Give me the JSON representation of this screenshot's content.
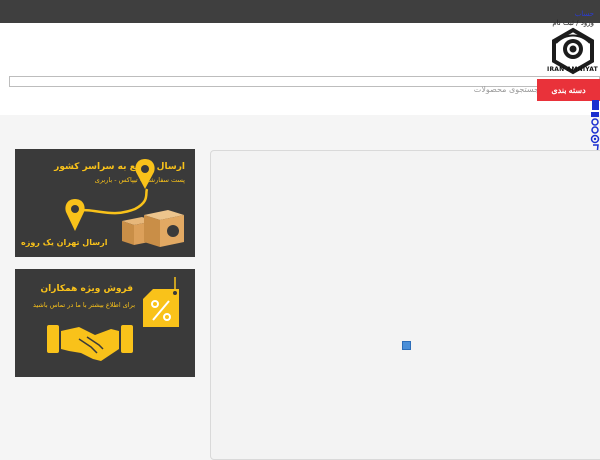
{
  "header": {
    "account_link": "حساب",
    "login_register": "ورود / ثبت نام",
    "brand": "IRAN AMNIYAT"
  },
  "search": {
    "placeholder": "جستجوی محصولات"
  },
  "category_button": "دسته بندی",
  "banners": [
    {
      "title": "ارسال سریع به سراسر کشور",
      "subtitle": "پست سفارشی - تیپاکس - باربری",
      "footer": "ارسال تهران یک روزه"
    },
    {
      "title": "فروش ویژه همکاران",
      "subtitle": "برای اطلاع بیشتر با ما در تماس باشید"
    }
  ],
  "colors": {
    "accent": "#e9323a",
    "banner_bg": "#3a3a3a",
    "banner_text": "#f9c21a",
    "topbar": "#3f3f3f"
  },
  "icons": [
    "camera-logo-icon",
    "location-pin-icon",
    "boxes-icon",
    "price-tag-icon",
    "handshake-icon",
    "broken-image-icon"
  ]
}
